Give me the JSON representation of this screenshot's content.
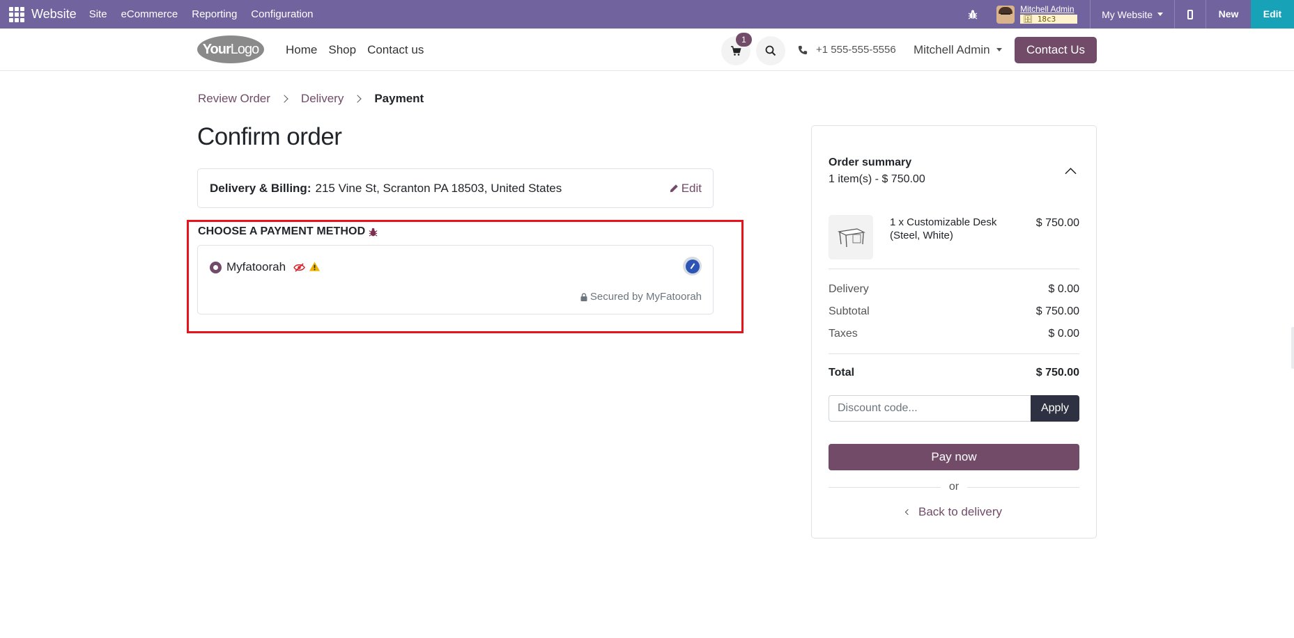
{
  "topbar": {
    "app_name": "Website",
    "menus": [
      "Site",
      "eCommerce",
      "Reporting",
      "Configuration"
    ],
    "user_name": "Mitchell Admin",
    "db_name": "18c3",
    "website_selector": "My Website",
    "new_label": "New",
    "edit_label": "Edit",
    "bar_color": "#71639e",
    "edit_color": "#17a2b8"
  },
  "header": {
    "logo_bold": "Your",
    "logo_regular": "Logo",
    "nav": [
      "Home",
      "Shop",
      "Contact us"
    ],
    "cart_count": "1",
    "phone": "+1 555-555-5556",
    "user_menu": "Mitchell Admin",
    "contact_button": "Contact Us",
    "brand_color": "#714b67"
  },
  "checkout": {
    "breadcrumb": [
      "Review Order",
      "Delivery",
      "Payment"
    ],
    "title": "Confirm order",
    "address_label": "Delivery & Billing:",
    "address_value": "215 Vine St, Scranton PA 18503, United States",
    "edit_label": "Edit",
    "payment_title": "CHOOSE A PAYMENT METHOD",
    "payment_method": "Myfatoorah",
    "secured_by": "Secured by MyFatoorah",
    "highlight_color": "#e8121b"
  },
  "summary": {
    "title": "Order summary",
    "subtitle": "1 item(s) -  $ 750.00",
    "product_name": "1 x Customizable Desk (Steel, White)",
    "product_price": "$ 750.00",
    "rows": [
      {
        "label": "Delivery",
        "value": "$ 0.00"
      },
      {
        "label": "Subtotal",
        "value": "$ 750.00"
      },
      {
        "label": "Taxes",
        "value": "$ 0.00"
      }
    ],
    "total_label": "Total",
    "total_value": "$ 750.00",
    "discount_placeholder": "Discount code...",
    "apply_label": "Apply",
    "pay_label": "Pay now",
    "or_label": "or",
    "back_label": "Back to delivery"
  }
}
